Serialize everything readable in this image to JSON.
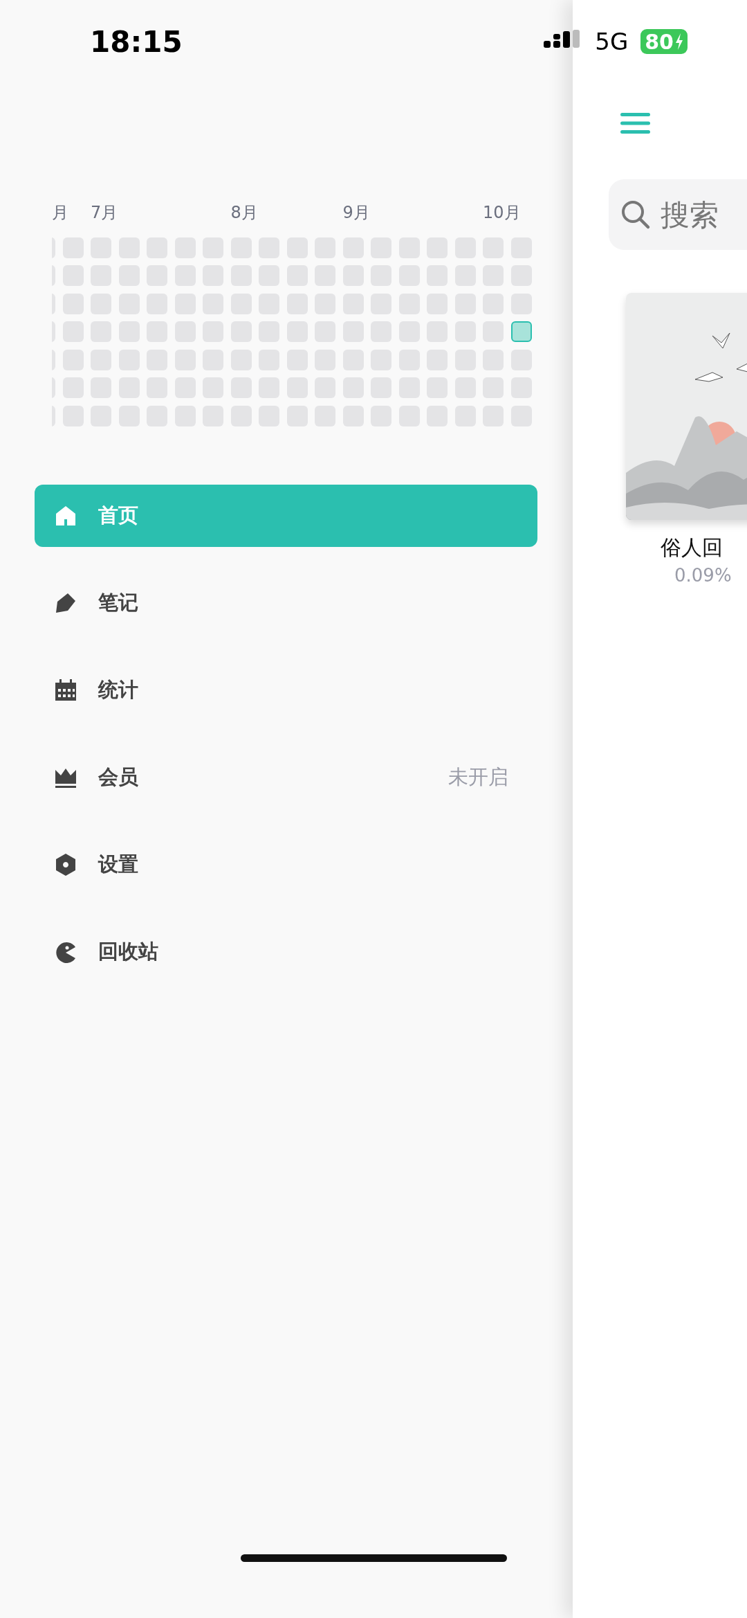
{
  "status_bar": {
    "time": "18:15",
    "network": "5G",
    "battery": "80"
  },
  "heatmap": {
    "weeks": [
      {
        "month": "月",
        "days": [
          false,
          false,
          false,
          false,
          false,
          false,
          false
        ]
      },
      {
        "days": [
          false,
          false,
          false,
          false,
          false,
          false,
          false
        ]
      },
      {
        "month": "7月",
        "days": [
          false,
          false,
          false,
          false,
          false,
          false,
          false
        ]
      },
      {
        "days": [
          false,
          false,
          false,
          false,
          false,
          false,
          false
        ]
      },
      {
        "days": [
          false,
          false,
          false,
          false,
          false,
          false,
          false
        ]
      },
      {
        "days": [
          false,
          false,
          false,
          false,
          false,
          false,
          false
        ]
      },
      {
        "days": [
          false,
          false,
          false,
          false,
          false,
          false,
          false
        ]
      },
      {
        "month": "8月",
        "days": [
          false,
          false,
          false,
          false,
          false,
          false,
          false
        ]
      },
      {
        "days": [
          false,
          false,
          false,
          false,
          false,
          false,
          false
        ]
      },
      {
        "days": [
          false,
          false,
          false,
          false,
          false,
          false,
          false
        ]
      },
      {
        "days": [
          false,
          false,
          false,
          false,
          false,
          false,
          false
        ]
      },
      {
        "month": "9月",
        "days": [
          false,
          false,
          false,
          false,
          false,
          false,
          false
        ]
      },
      {
        "days": [
          false,
          false,
          false,
          false,
          false,
          false,
          false
        ]
      },
      {
        "days": [
          false,
          false,
          false,
          false,
          false,
          false,
          false
        ]
      },
      {
        "days": [
          false,
          false,
          false,
          false,
          false,
          false,
          false
        ]
      },
      {
        "days": [
          false,
          false,
          false,
          false,
          false,
          false,
          false
        ]
      },
      {
        "month": "10月",
        "days": [
          false,
          false,
          false,
          false,
          false,
          false,
          false
        ]
      },
      {
        "days": [
          false,
          false,
          false,
          true,
          false,
          false,
          false
        ]
      }
    ]
  },
  "menu": [
    {
      "label": "首页",
      "selected": true
    },
    {
      "label": "笔记",
      "selected": false
    },
    {
      "label": "统计",
      "selected": false
    },
    {
      "label": "会员",
      "selected": false,
      "badge": "未开启"
    },
    {
      "label": "设置",
      "selected": false
    },
    {
      "label": "回收站",
      "selected": false
    }
  ],
  "main": {
    "search": {
      "placeholder": "搜索"
    },
    "books": [
      {
        "kind": "picture",
        "title": "俗人回",
        "progress": "0.09%"
      }
    ]
  }
}
